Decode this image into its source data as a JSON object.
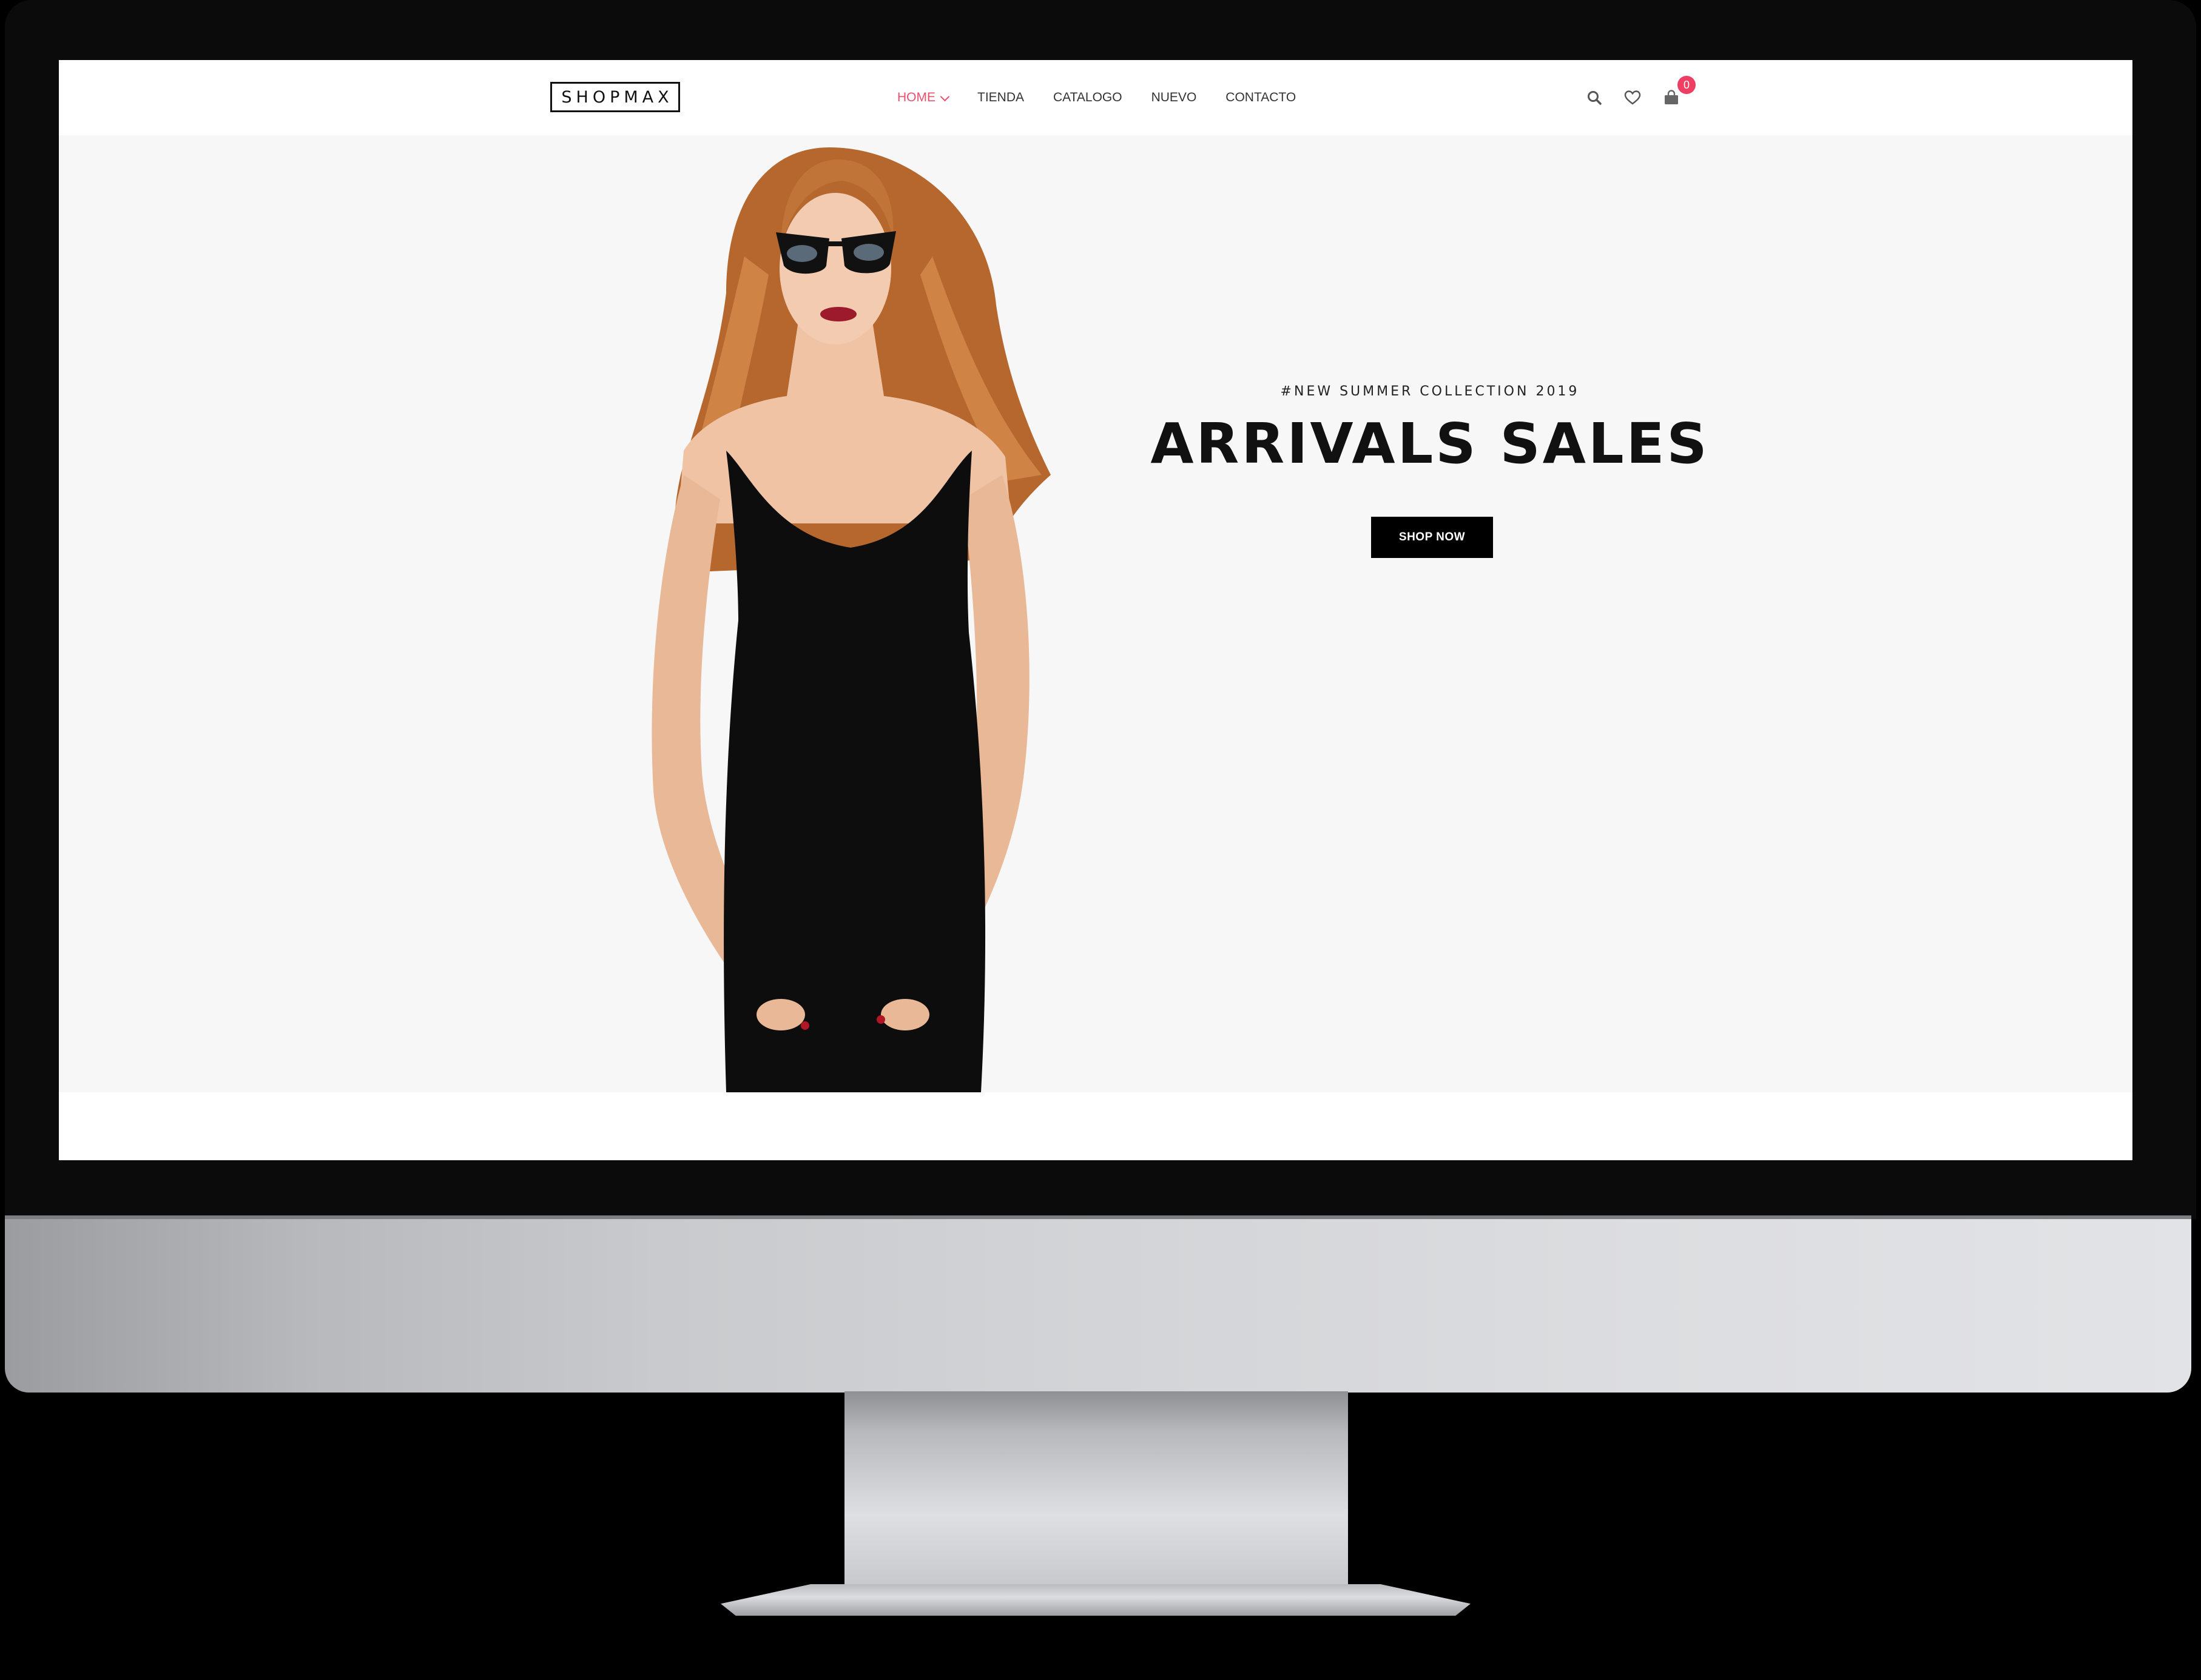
{
  "header": {
    "logo": "SHOPMAX",
    "nav": [
      {
        "label": "HOME",
        "active": true
      },
      {
        "label": "TIENDA",
        "active": false
      },
      {
        "label": "CATALOGO",
        "active": false
      },
      {
        "label": "NUEVO",
        "active": false
      },
      {
        "label": "CONTACTO",
        "active": false
      }
    ],
    "icons": [
      "search-icon",
      "heart-icon",
      "shopping-bag-icon"
    ],
    "cart_count": "0"
  },
  "hero": {
    "kicker": "#NEW SUMMER COLLECTION 2019",
    "headline": "ARRIVALS SALES",
    "cta_label": "SHOP NOW"
  },
  "colors": {
    "accent": "#e8506d",
    "badge": "#ee3f63",
    "hero_background": "#f7f7f7",
    "button": "#000000"
  }
}
